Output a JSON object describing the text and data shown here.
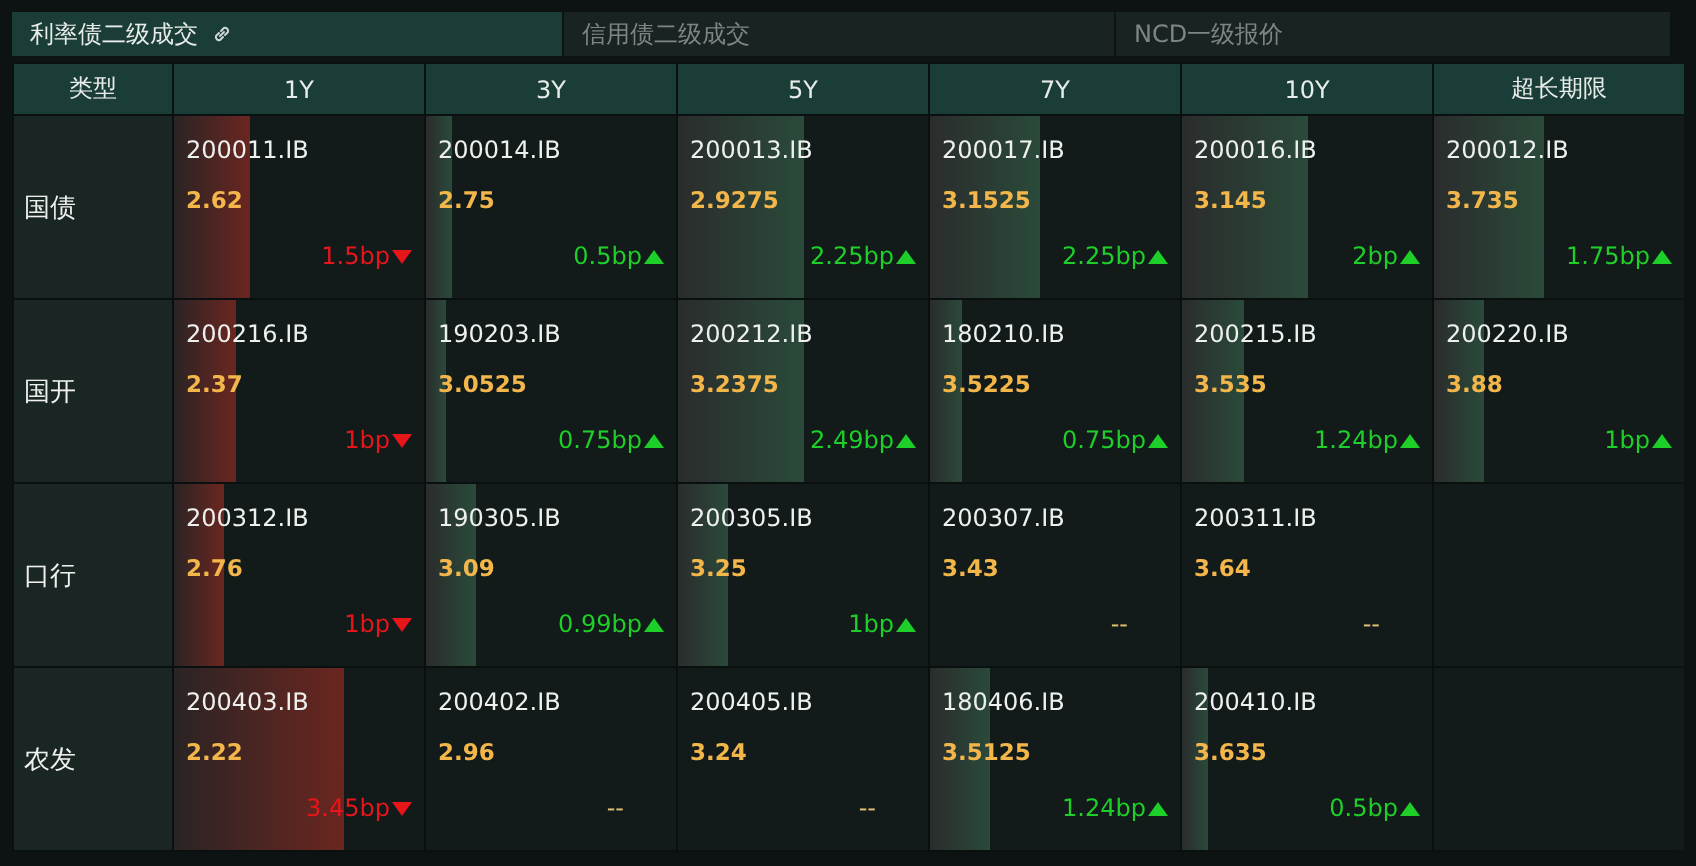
{
  "tabs": [
    {
      "label": "利率债二级成交",
      "selected": true,
      "linked": true
    },
    {
      "label": "信用债二级成交",
      "selected": false,
      "linked": false
    },
    {
      "label": "NCD一级报价",
      "selected": false,
      "linked": false
    }
  ],
  "table": {
    "type_header": "类型",
    "columns": [
      "1Y",
      "3Y",
      "5Y",
      "7Y",
      "10Y",
      "超长期限"
    ],
    "rows": [
      {
        "type": "国债",
        "cells": [
          {
            "kind": "down",
            "code": "200011.IB",
            "yield": "2.62",
            "change": "1.5bp",
            "level": 0.3
          },
          {
            "kind": "up",
            "code": "200014.IB",
            "yield": "2.75",
            "change": "0.5bp",
            "level": 0.1
          },
          {
            "kind": "up",
            "code": "200013.IB",
            "yield": "2.9275",
            "change": "2.25bp",
            "level": 0.5
          },
          {
            "kind": "up",
            "code": "200017.IB",
            "yield": "3.1525",
            "change": "2.25bp",
            "level": 0.44
          },
          {
            "kind": "up",
            "code": "200016.IB",
            "yield": "3.145",
            "change": "2bp",
            "level": 0.5
          },
          {
            "kind": "up",
            "code": "200012.IB",
            "yield": "3.735",
            "change": "1.75bp",
            "level": 0.44
          }
        ]
      },
      {
        "type": "国开",
        "cells": [
          {
            "kind": "down",
            "code": "200216.IB",
            "yield": "2.37",
            "change": "1bp",
            "level": 0.25
          },
          {
            "kind": "up",
            "code": "190203.IB",
            "yield": "3.0525",
            "change": "0.75bp",
            "level": 0.08
          },
          {
            "kind": "up",
            "code": "200212.IB",
            "yield": "3.2375",
            "change": "2.49bp",
            "level": 0.5
          },
          {
            "kind": "up",
            "code": "180210.IB",
            "yield": "3.5225",
            "change": "0.75bp",
            "level": 0.13
          },
          {
            "kind": "up",
            "code": "200215.IB",
            "yield": "3.535",
            "change": "1.24bp",
            "level": 0.25
          },
          {
            "kind": "up",
            "code": "200220.IB",
            "yield": "3.88",
            "change": "1bp",
            "level": 0.2
          }
        ]
      },
      {
        "type": "口行",
        "cells": [
          {
            "kind": "down",
            "code": "200312.IB",
            "yield": "2.76",
            "change": "1bp",
            "level": 0.2
          },
          {
            "kind": "up",
            "code": "190305.IB",
            "yield": "3.09",
            "change": "0.99bp",
            "level": 0.2
          },
          {
            "kind": "up",
            "code": "200305.IB",
            "yield": "3.25",
            "change": "1bp",
            "level": 0.2
          },
          {
            "kind": "flat",
            "code": "200307.IB",
            "yield": "3.43",
            "change": "--"
          },
          {
            "kind": "flat",
            "code": "200311.IB",
            "yield": "3.64",
            "change": "--"
          },
          {
            "kind": "empty"
          }
        ]
      },
      {
        "type": "农发",
        "cells": [
          {
            "kind": "down",
            "code": "200403.IB",
            "yield": "2.22",
            "change": "3.45bp",
            "level": 0.68
          },
          {
            "kind": "flat",
            "code": "200402.IB",
            "yield": "2.96",
            "change": "--"
          },
          {
            "kind": "flat",
            "code": "200405.IB",
            "yield": "3.24",
            "change": "--"
          },
          {
            "kind": "up",
            "code": "180406.IB",
            "yield": "3.5125",
            "change": "1.24bp",
            "level": 0.24
          },
          {
            "kind": "up",
            "code": "200410.IB",
            "yield": "3.635",
            "change": "0.5bp",
            "level": 0.1
          },
          {
            "kind": "empty"
          }
        ]
      }
    ]
  }
}
